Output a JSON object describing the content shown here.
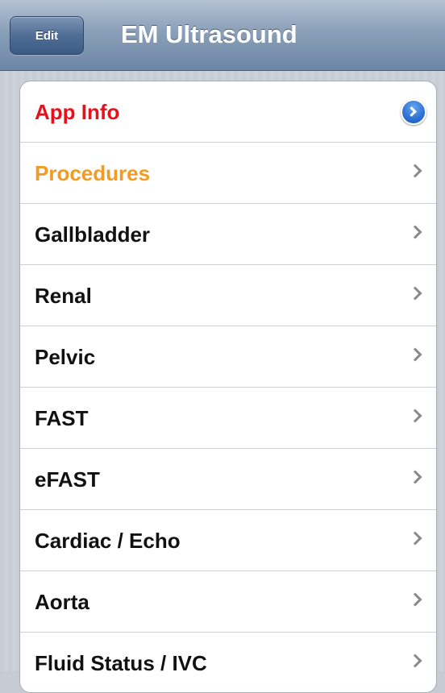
{
  "navbar": {
    "edit_label": "Edit",
    "title": "EM Ultrasound"
  },
  "list": {
    "items": [
      {
        "label": "App Info",
        "accessory": "detail-disclosure"
      },
      {
        "label": "Procedures",
        "accessory": "chevron"
      },
      {
        "label": "Gallbladder",
        "accessory": "chevron"
      },
      {
        "label": "Renal",
        "accessory": "chevron"
      },
      {
        "label": "Pelvic",
        "accessory": "chevron"
      },
      {
        "label": "FAST",
        "accessory": "chevron"
      },
      {
        "label": "eFAST",
        "accessory": "chevron"
      },
      {
        "label": "Cardiac / Echo",
        "accessory": "chevron"
      },
      {
        "label": "Aorta",
        "accessory": "chevron"
      },
      {
        "label": "Fluid Status / IVC",
        "accessory": "chevron"
      }
    ]
  },
  "colors": {
    "app_info_text": "#e8101a",
    "procedures_text": "#f39a23",
    "default_text": "#111111",
    "disclosure_blue": "#2f74d6"
  }
}
